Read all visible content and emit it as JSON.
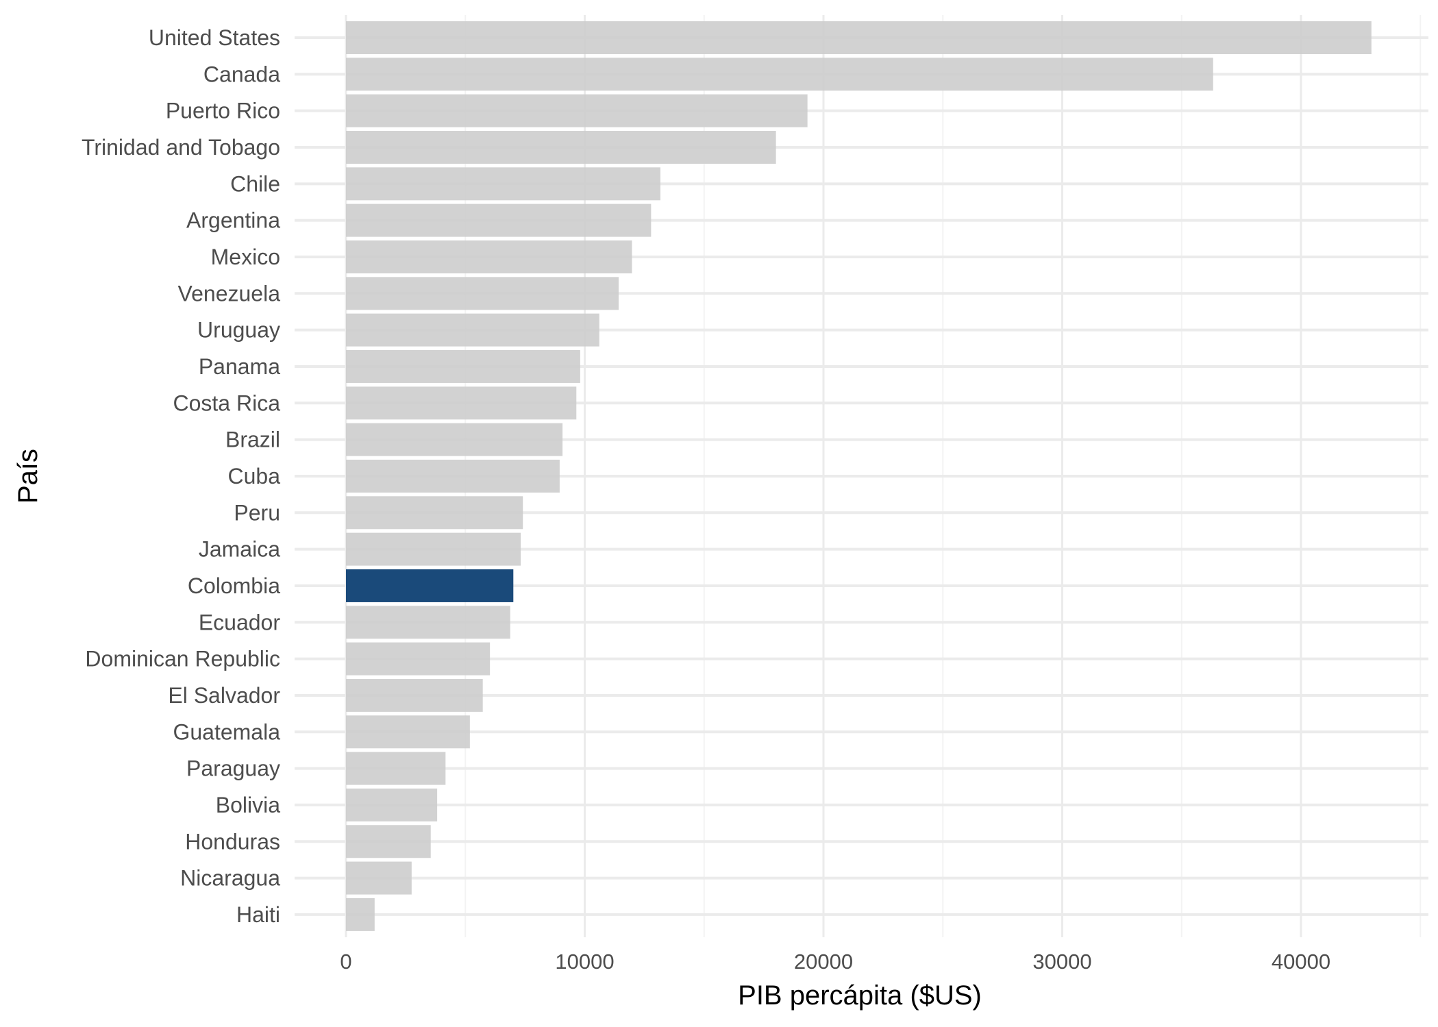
{
  "chart_data": {
    "type": "bar",
    "orientation": "horizontal",
    "title": "",
    "xlabel": "PIB percápita ($US)",
    "ylabel": "País",
    "xlim": [
      0,
      45000
    ],
    "x_ticks": [
      0,
      10000,
      20000,
      30000,
      40000
    ],
    "x_tick_labels": [
      "0",
      "10000",
      "20000",
      "30000",
      "40000"
    ],
    "x_minor_ticks": [
      5000,
      15000,
      25000,
      35000,
      45000
    ],
    "grid": true,
    "legend": "none",
    "highlight_category": "Colombia",
    "colors": {
      "default": "#cccccc",
      "highlight": "#1a4a7a",
      "grid_major": "#ebebeb",
      "grid_minor": "#f3f3f3"
    },
    "categories": [
      "United States",
      "Canada",
      "Puerto Rico",
      "Trinidad and Tobago",
      "Chile",
      "Argentina",
      "Mexico",
      "Venezuela",
      "Uruguay",
      "Panama",
      "Costa Rica",
      "Brazil",
      "Cuba",
      "Peru",
      "Jamaica",
      "Colombia",
      "Ecuador",
      "Dominican Republic",
      "El Salvador",
      "Guatemala",
      "Paraguay",
      "Bolivia",
      "Honduras",
      "Nicaragua",
      "Haiti"
    ],
    "values": [
      42950,
      36320,
      19330,
      18010,
      13170,
      12780,
      11980,
      11420,
      10610,
      9810,
      9650,
      9070,
      8950,
      7410,
      7320,
      7010,
      6880,
      6030,
      5730,
      5190,
      4170,
      3820,
      3550,
      2750,
      1200
    ]
  }
}
